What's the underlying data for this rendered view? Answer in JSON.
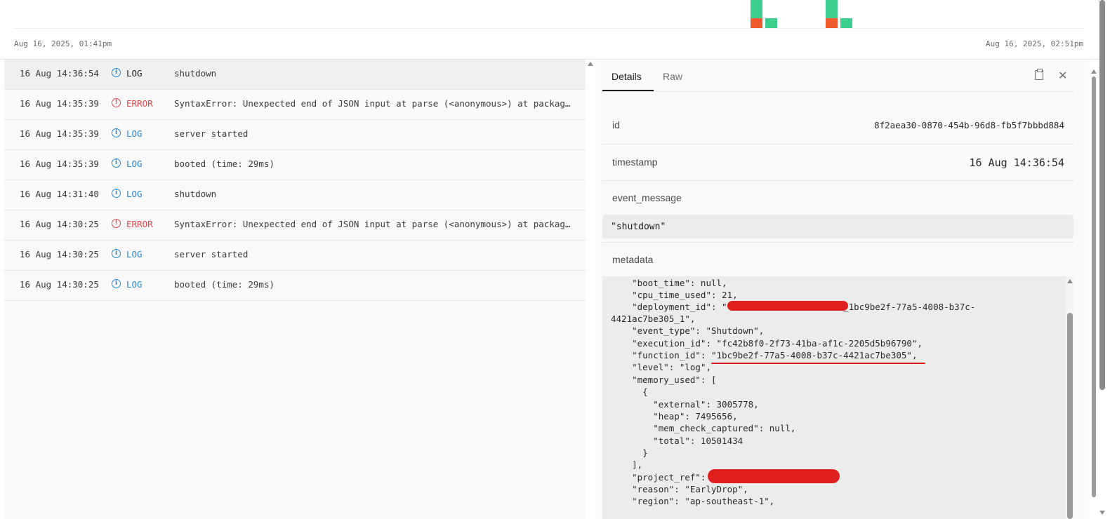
{
  "chart": {
    "start_label": "Aug 16, 2025, 01:41pm",
    "end_label": "Aug 16, 2025, 02:51pm",
    "colors": {
      "log": "#3ecf8e",
      "error": "#ef5a2e"
    }
  },
  "logs": [
    {
      "time": "16 Aug 14:36:54",
      "level": "LOG",
      "message": "shutdown"
    },
    {
      "time": "16 Aug 14:35:39",
      "level": "ERROR",
      "message": "SyntaxError: Unexpected end of JSON input at parse (<anonymous>) at packag…"
    },
    {
      "time": "16 Aug 14:35:39",
      "level": "LOG",
      "message": "server started"
    },
    {
      "time": "16 Aug 14:35:39",
      "level": "LOG",
      "message": "booted (time: 29ms)"
    },
    {
      "time": "16 Aug 14:31:40",
      "level": "LOG",
      "message": "shutdown"
    },
    {
      "time": "16 Aug 14:30:25",
      "level": "ERROR",
      "message": "SyntaxError: Unexpected end of JSON input at parse (<anonymous>) at packag…"
    },
    {
      "time": "16 Aug 14:30:25",
      "level": "LOG",
      "message": "server started"
    },
    {
      "time": "16 Aug 14:30:25",
      "level": "LOG",
      "message": "booted (time: 29ms)"
    }
  ],
  "details": {
    "tabs": [
      "Details",
      "Raw"
    ],
    "id_key": "id",
    "id_value": "8f2aea30-0870-454b-96d8-fb5f7bbbd884",
    "timestamp_key": "timestamp",
    "timestamp_value": "16 Aug 14:36:54",
    "event_message_key": "event_message",
    "event_message_value": "\"shutdown\"",
    "metadata_key": "metadata",
    "metadata_lines": [
      "    \"boot_time\": null,",
      "    \"cpu_time_used\": 21,",
      "    \"deployment_id\": \"                      _1bc9be2f-77a5-4008-b37c-",
      "4421ac7be305_1\",",
      "    \"event_type\": \"Shutdown\",",
      "    \"execution_id\": \"fc42b8f0-2f73-41ba-af1c-2205d5b96790\",",
      "    \"function_id\": \"1bc9be2f-77a5-4008-b37c-4421ac7be305\",",
      "    \"level\": \"log\",",
      "    \"memory_used\": [",
      "      {",
      "        \"external\": 3005778,",
      "        \"heap\": 7495656,",
      "        \"mem_check_captured\": null,",
      "        \"total\": 10501434",
      "      }",
      "    ],",
      "    \"project_ref\":",
      "    \"reason\": \"EarlyDrop\",",
      "    \"region\": \"ap-southeast-1\","
    ]
  }
}
